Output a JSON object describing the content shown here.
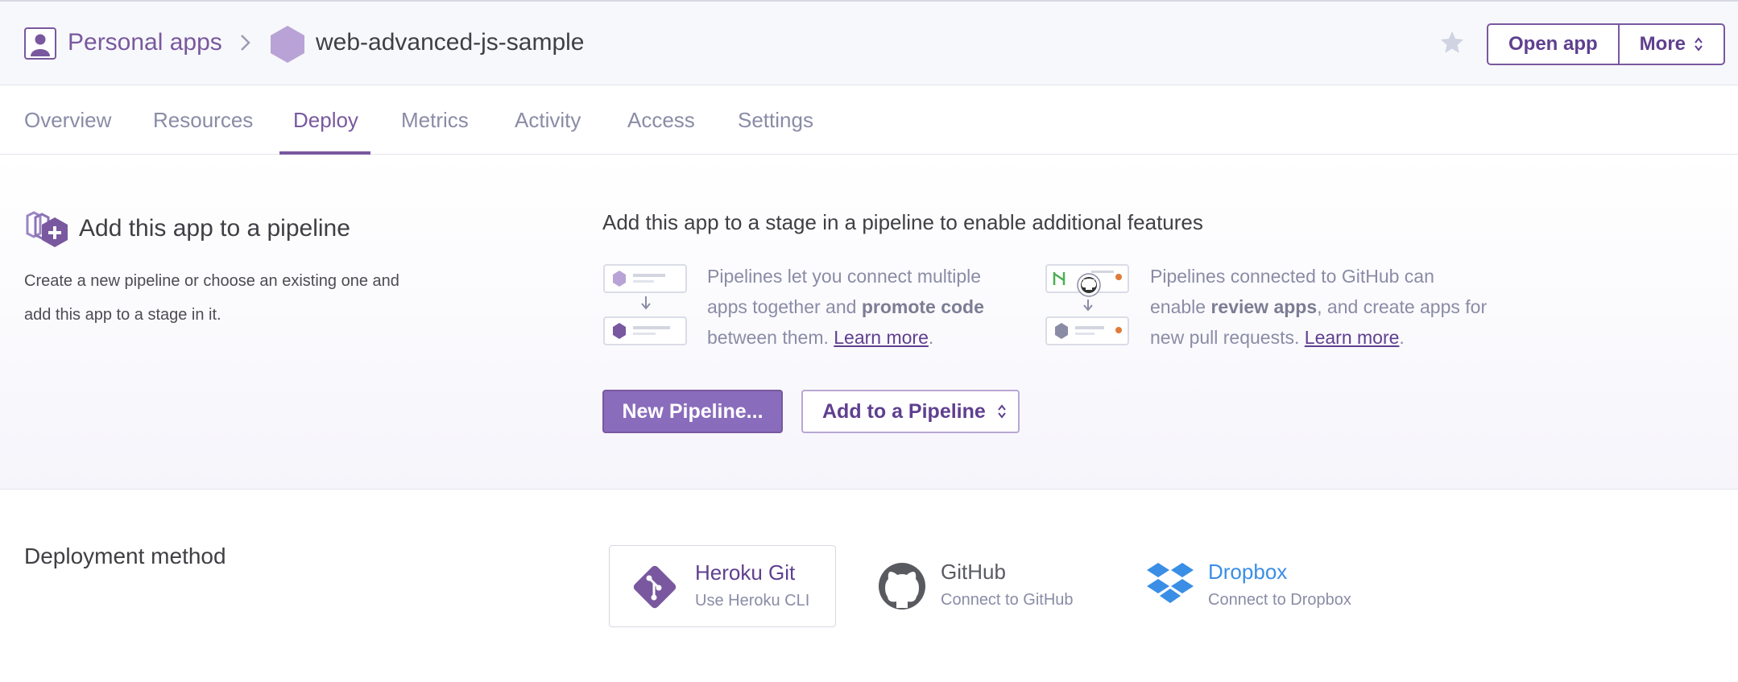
{
  "colors": {
    "brand": "#79589f",
    "muted": "#8a8ca6",
    "dropbox": "#3a8ee6"
  },
  "header": {
    "personal_apps": "Personal apps",
    "app_name": "web-advanced-js-sample",
    "open_app": "Open app",
    "more": "More"
  },
  "tabs": [
    "Overview",
    "Resources",
    "Deploy",
    "Metrics",
    "Activity",
    "Access",
    "Settings"
  ],
  "active_tab": "Deploy",
  "pipeline": {
    "title": "Add this app to a pipeline",
    "description": "Create a new pipeline or choose an existing one and add this app to a stage in it.",
    "heading": "Add this app to a stage in a pipeline to enable additional features",
    "feature1": {
      "text_a": "Pipelines let you connect multiple apps together and ",
      "bold": "promote code",
      "text_b": " between them. ",
      "link": "Learn more",
      "end": "."
    },
    "feature2": {
      "text_a": "Pipelines connected to GitHub can enable ",
      "bold": "review apps",
      "text_b": ", and create apps for new pull requests. ",
      "link": "Learn more",
      "end": "."
    },
    "new_pipeline": "New Pipeline...",
    "add_to_pipeline": "Add to a Pipeline"
  },
  "deployment": {
    "label": "Deployment method",
    "methods": [
      {
        "name": "Heroku Git",
        "sub": "Use Heroku CLI",
        "icon": "heroku-git-icon"
      },
      {
        "name": "GitHub",
        "sub": "Connect to GitHub",
        "icon": "github-icon"
      },
      {
        "name": "Dropbox",
        "sub": "Connect to Dropbox",
        "icon": "dropbox-icon"
      }
    ]
  }
}
